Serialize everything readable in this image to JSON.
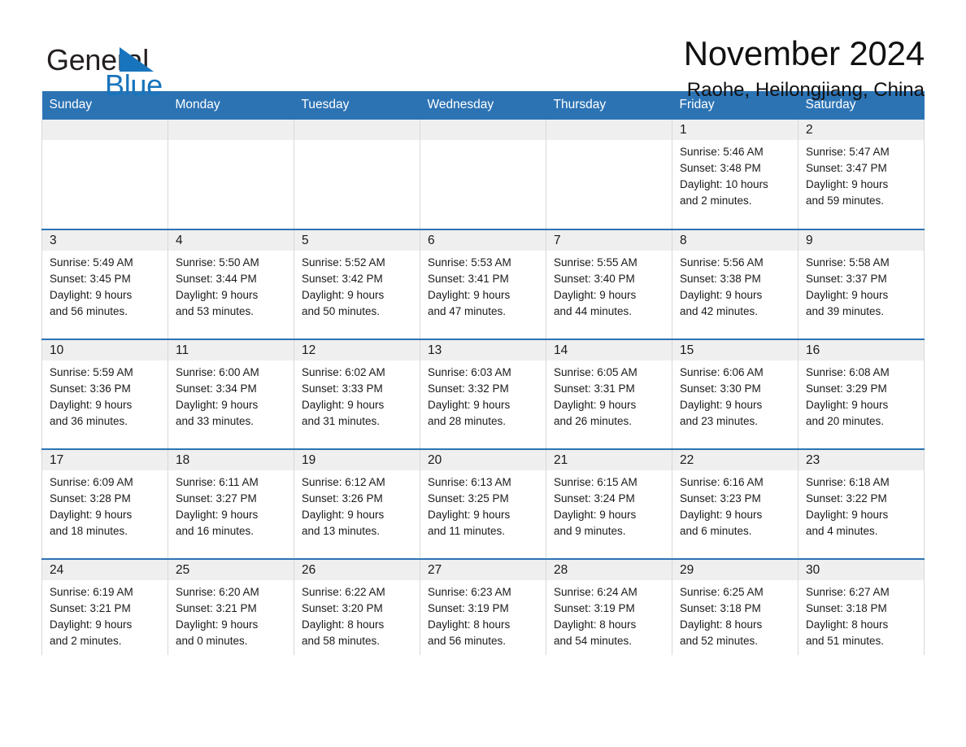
{
  "brand": {
    "word_one": "General",
    "word_two": "Blue",
    "triangle_icon": "blue-triangle-icon",
    "accent_color": "#1874bc"
  },
  "header": {
    "month_title": "November 2024",
    "location": "Raohe, Heilongjiang, China"
  },
  "theme": {
    "header_blue": "#2c73b4",
    "date_band_gray": "#efefef",
    "cell_border": "#d8d8d8",
    "text": "#1a1a1a"
  },
  "weekday_headers": [
    "Sunday",
    "Monday",
    "Tuesday",
    "Wednesday",
    "Thursday",
    "Friday",
    "Saturday"
  ],
  "labels": {
    "sunrise_prefix": "Sunrise:",
    "sunset_prefix": "Sunset:",
    "daylight_prefix": "Daylight:"
  },
  "weeks": [
    [
      {
        "day": "",
        "empty": true
      },
      {
        "day": "",
        "empty": true
      },
      {
        "day": "",
        "empty": true
      },
      {
        "day": "",
        "empty": true
      },
      {
        "day": "",
        "empty": true
      },
      {
        "day": "1",
        "sunrise": "Sunrise: 5:46 AM",
        "sunset": "Sunset: 3:48 PM",
        "daylight_line1": "Daylight: 10 hours",
        "daylight_line2": "and 2 minutes."
      },
      {
        "day": "2",
        "sunrise": "Sunrise: 5:47 AM",
        "sunset": "Sunset: 3:47 PM",
        "daylight_line1": "Daylight: 9 hours",
        "daylight_line2": "and 59 minutes."
      }
    ],
    [
      {
        "day": "3",
        "sunrise": "Sunrise: 5:49 AM",
        "sunset": "Sunset: 3:45 PM",
        "daylight_line1": "Daylight: 9 hours",
        "daylight_line2": "and 56 minutes."
      },
      {
        "day": "4",
        "sunrise": "Sunrise: 5:50 AM",
        "sunset": "Sunset: 3:44 PM",
        "daylight_line1": "Daylight: 9 hours",
        "daylight_line2": "and 53 minutes."
      },
      {
        "day": "5",
        "sunrise": "Sunrise: 5:52 AM",
        "sunset": "Sunset: 3:42 PM",
        "daylight_line1": "Daylight: 9 hours",
        "daylight_line2": "and 50 minutes."
      },
      {
        "day": "6",
        "sunrise": "Sunrise: 5:53 AM",
        "sunset": "Sunset: 3:41 PM",
        "daylight_line1": "Daylight: 9 hours",
        "daylight_line2": "and 47 minutes."
      },
      {
        "day": "7",
        "sunrise": "Sunrise: 5:55 AM",
        "sunset": "Sunset: 3:40 PM",
        "daylight_line1": "Daylight: 9 hours",
        "daylight_line2": "and 44 minutes."
      },
      {
        "day": "8",
        "sunrise": "Sunrise: 5:56 AM",
        "sunset": "Sunset: 3:38 PM",
        "daylight_line1": "Daylight: 9 hours",
        "daylight_line2": "and 42 minutes."
      },
      {
        "day": "9",
        "sunrise": "Sunrise: 5:58 AM",
        "sunset": "Sunset: 3:37 PM",
        "daylight_line1": "Daylight: 9 hours",
        "daylight_line2": "and 39 minutes."
      }
    ],
    [
      {
        "day": "10",
        "sunrise": "Sunrise: 5:59 AM",
        "sunset": "Sunset: 3:36 PM",
        "daylight_line1": "Daylight: 9 hours",
        "daylight_line2": "and 36 minutes."
      },
      {
        "day": "11",
        "sunrise": "Sunrise: 6:00 AM",
        "sunset": "Sunset: 3:34 PM",
        "daylight_line1": "Daylight: 9 hours",
        "daylight_line2": "and 33 minutes."
      },
      {
        "day": "12",
        "sunrise": "Sunrise: 6:02 AM",
        "sunset": "Sunset: 3:33 PM",
        "daylight_line1": "Daylight: 9 hours",
        "daylight_line2": "and 31 minutes."
      },
      {
        "day": "13",
        "sunrise": "Sunrise: 6:03 AM",
        "sunset": "Sunset: 3:32 PM",
        "daylight_line1": "Daylight: 9 hours",
        "daylight_line2": "and 28 minutes."
      },
      {
        "day": "14",
        "sunrise": "Sunrise: 6:05 AM",
        "sunset": "Sunset: 3:31 PM",
        "daylight_line1": "Daylight: 9 hours",
        "daylight_line2": "and 26 minutes."
      },
      {
        "day": "15",
        "sunrise": "Sunrise: 6:06 AM",
        "sunset": "Sunset: 3:30 PM",
        "daylight_line1": "Daylight: 9 hours",
        "daylight_line2": "and 23 minutes."
      },
      {
        "day": "16",
        "sunrise": "Sunrise: 6:08 AM",
        "sunset": "Sunset: 3:29 PM",
        "daylight_line1": "Daylight: 9 hours",
        "daylight_line2": "and 20 minutes."
      }
    ],
    [
      {
        "day": "17",
        "sunrise": "Sunrise: 6:09 AM",
        "sunset": "Sunset: 3:28 PM",
        "daylight_line1": "Daylight: 9 hours",
        "daylight_line2": "and 18 minutes."
      },
      {
        "day": "18",
        "sunrise": "Sunrise: 6:11 AM",
        "sunset": "Sunset: 3:27 PM",
        "daylight_line1": "Daylight: 9 hours",
        "daylight_line2": "and 16 minutes."
      },
      {
        "day": "19",
        "sunrise": "Sunrise: 6:12 AM",
        "sunset": "Sunset: 3:26 PM",
        "daylight_line1": "Daylight: 9 hours",
        "daylight_line2": "and 13 minutes."
      },
      {
        "day": "20",
        "sunrise": "Sunrise: 6:13 AM",
        "sunset": "Sunset: 3:25 PM",
        "daylight_line1": "Daylight: 9 hours",
        "daylight_line2": "and 11 minutes."
      },
      {
        "day": "21",
        "sunrise": "Sunrise: 6:15 AM",
        "sunset": "Sunset: 3:24 PM",
        "daylight_line1": "Daylight: 9 hours",
        "daylight_line2": "and 9 minutes."
      },
      {
        "day": "22",
        "sunrise": "Sunrise: 6:16 AM",
        "sunset": "Sunset: 3:23 PM",
        "daylight_line1": "Daylight: 9 hours",
        "daylight_line2": "and 6 minutes."
      },
      {
        "day": "23",
        "sunrise": "Sunrise: 6:18 AM",
        "sunset": "Sunset: 3:22 PM",
        "daylight_line1": "Daylight: 9 hours",
        "daylight_line2": "and 4 minutes."
      }
    ],
    [
      {
        "day": "24",
        "sunrise": "Sunrise: 6:19 AM",
        "sunset": "Sunset: 3:21 PM",
        "daylight_line1": "Daylight: 9 hours",
        "daylight_line2": "and 2 minutes."
      },
      {
        "day": "25",
        "sunrise": "Sunrise: 6:20 AM",
        "sunset": "Sunset: 3:21 PM",
        "daylight_line1": "Daylight: 9 hours",
        "daylight_line2": "and 0 minutes."
      },
      {
        "day": "26",
        "sunrise": "Sunrise: 6:22 AM",
        "sunset": "Sunset: 3:20 PM",
        "daylight_line1": "Daylight: 8 hours",
        "daylight_line2": "and 58 minutes."
      },
      {
        "day": "27",
        "sunrise": "Sunrise: 6:23 AM",
        "sunset": "Sunset: 3:19 PM",
        "daylight_line1": "Daylight: 8 hours",
        "daylight_line2": "and 56 minutes."
      },
      {
        "day": "28",
        "sunrise": "Sunrise: 6:24 AM",
        "sunset": "Sunset: 3:19 PM",
        "daylight_line1": "Daylight: 8 hours",
        "daylight_line2": "and 54 minutes."
      },
      {
        "day": "29",
        "sunrise": "Sunrise: 6:25 AM",
        "sunset": "Sunset: 3:18 PM",
        "daylight_line1": "Daylight: 8 hours",
        "daylight_line2": "and 52 minutes."
      },
      {
        "day": "30",
        "sunrise": "Sunrise: 6:27 AM",
        "sunset": "Sunset: 3:18 PM",
        "daylight_line1": "Daylight: 8 hours",
        "daylight_line2": "and 51 minutes."
      }
    ]
  ]
}
